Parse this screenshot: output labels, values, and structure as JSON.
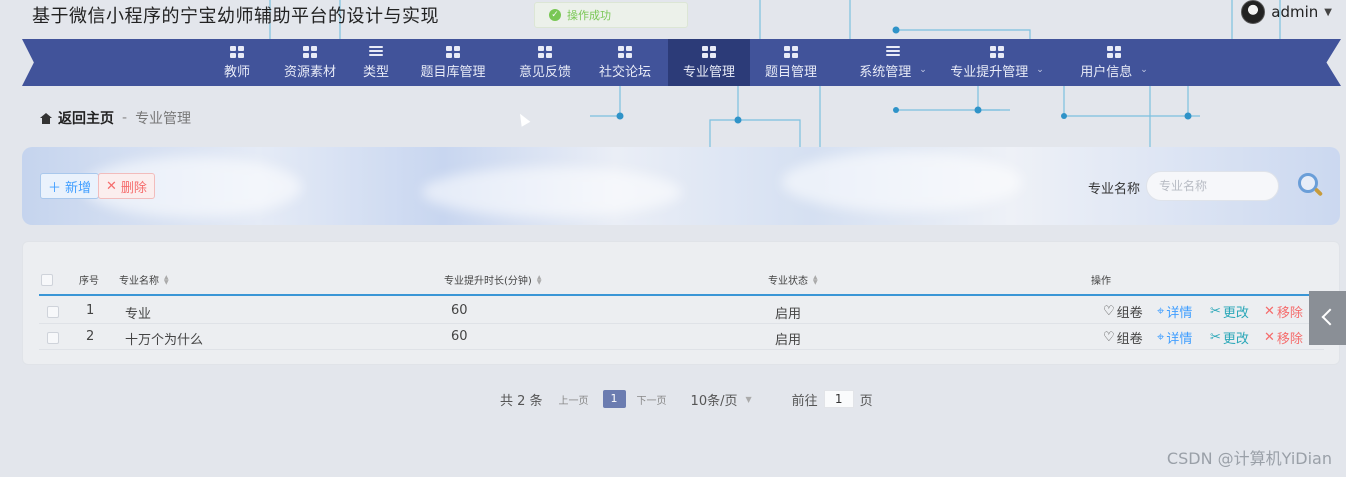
{
  "app": {
    "title": "基于微信小程序的宁宝幼师辅助平台的设计与实现"
  },
  "user": {
    "name": "admin"
  },
  "toast": {
    "message": "操作成功"
  },
  "nav": {
    "items": [
      {
        "label": "教师",
        "icon": "grid-icon"
      },
      {
        "label": "资源素材",
        "icon": "file-icon"
      },
      {
        "label": "类型",
        "icon": "list-icon"
      },
      {
        "label": "题目库管理",
        "icon": "folder-icon"
      },
      {
        "label": "意见反馈",
        "icon": "grid-icon"
      },
      {
        "label": "社交论坛",
        "icon": "grid-icon"
      },
      {
        "label": "专业管理",
        "icon": "pin-icon",
        "active": true
      },
      {
        "label": "题目管理",
        "icon": "grid-icon"
      },
      {
        "label": "系统管理",
        "icon": "list-icon",
        "dropdown": true
      },
      {
        "label": "专业提升管理",
        "icon": "book-icon",
        "dropdown": true
      },
      {
        "label": "用户信息",
        "icon": "card-icon",
        "dropdown": true
      }
    ]
  },
  "breadcrumb": {
    "home": "返回主页",
    "separator": "-",
    "current": "专业管理"
  },
  "toolbar": {
    "add_label": "新增",
    "delete_label": "删除"
  },
  "filter": {
    "label": "专业名称",
    "placeholder": "专业名称",
    "value": ""
  },
  "table": {
    "columns": [
      "序号",
      "专业名称",
      "专业提升时长(分钟)",
      "专业状态",
      "操作"
    ],
    "rows": [
      {
        "index": "1",
        "name": "专业",
        "duration": "60",
        "status": "启用"
      },
      {
        "index": "2",
        "name": "十万个为什么",
        "duration": "60",
        "status": "启用"
      }
    ],
    "actions": {
      "fav": "组卷",
      "detail": "详情",
      "edit": "更改",
      "remove": "移除"
    }
  },
  "pagination": {
    "total": "共 2 条",
    "prev": "上一页",
    "current": "1",
    "next": "下一页",
    "page_size": "10条/页",
    "goto_prefix": "前往",
    "goto_value": "1",
    "goto_suffix": "页"
  },
  "watermark": "CSDN @计算机YiDian",
  "colors": {
    "nav": "#41539a",
    "nav_active": "#2c3b78",
    "accent": "#409eff",
    "danger": "#f56c6c",
    "success": "#67c23a"
  }
}
